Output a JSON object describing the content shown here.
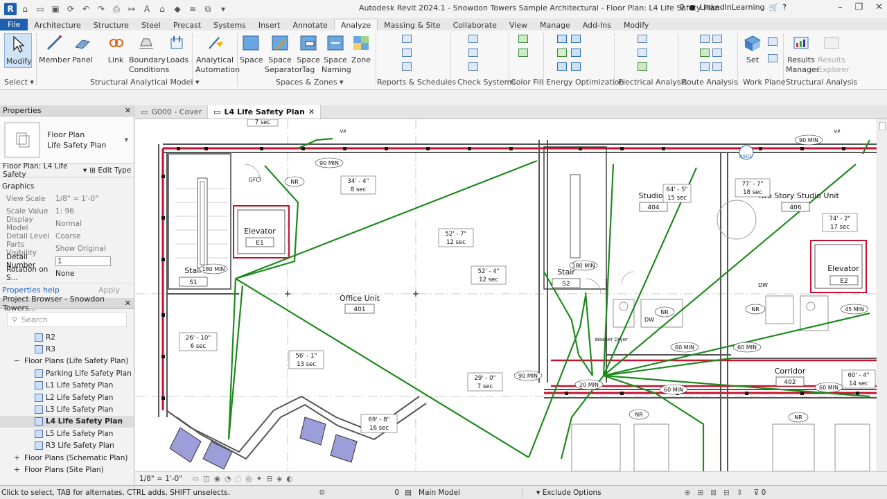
{
  "app": {
    "title": "Autodesk Revit 2024.1 - Snowdon Towers Sample Architectural - Floor Plan: L4 Life Safety Plan",
    "logo": "R",
    "account": "LinkedInLearning"
  },
  "menu_tabs": [
    "File",
    "Architecture",
    "Structure",
    "Steel",
    "Precast",
    "Systems",
    "Insert",
    "Annotate",
    "Analyze",
    "Massing & Site",
    "Collaborate",
    "View",
    "Manage",
    "Add-Ins",
    "Modify"
  ],
  "active_tab": "Analyze",
  "ribbon": {
    "modify": "Modify",
    "member": "Member",
    "panel": "Panel",
    "link": "Link",
    "boundary": "Boundary Conditions",
    "loads": "Loads",
    "analytical_automation": "Analytical Automation",
    "space": "Space",
    "space_separator": "Space Separator",
    "space_tag": "Space Tag",
    "space_naming": "Space Naming",
    "zone": "Zone",
    "set": "Set",
    "results_manager": "Results Manager",
    "results_explorer": "Results Explorer",
    "panels": {
      "select": "Select",
      "structural_analytical_model": "Structural Analytical Model",
      "spaces_zones": "Spaces & Zones",
      "reports": "Reports & Schedules",
      "check": "Check Systems",
      "color_fill": "Color Fill",
      "energy": "Energy Optimization",
      "electrical": "Electrical Analysis",
      "route": "Route Analysis",
      "work_plane": "Work Plane",
      "structural_analysis": "Structural Analysis"
    }
  },
  "properties": {
    "title": "Properties",
    "type_line1": "Floor Plan",
    "type_line2": "Life Safety Plan",
    "selector": "Floor Plan: L4 Life Safety",
    "edit_type": "Edit Type",
    "section": "Graphics",
    "rows": [
      {
        "k": "View Scale",
        "v": "1/8\" = 1'-0\""
      },
      {
        "k": "Scale Value",
        "v": "1:  96"
      },
      {
        "k": "Display Model",
        "v": "Normal"
      },
      {
        "k": "Detail Level",
        "v": "Coarse"
      },
      {
        "k": "Parts Visibility",
        "v": "Show Original"
      },
      {
        "k": "Detail Number",
        "v": "1"
      },
      {
        "k": "Rotation on S...",
        "v": "None"
      }
    ],
    "help": "Properties help",
    "apply": "Apply"
  },
  "browser": {
    "title": "Project Browser - Snowdon Towers...",
    "search_placeholder": "Search",
    "items": [
      "R2",
      "R3",
      "Floor Plans (Life Safety Plan)",
      "Parking Life Safety Plan",
      "L1 Life Safety Plan",
      "L2 Life Safety Plan",
      "L3 Life Safety Plan",
      "L4 Life Safety Plan",
      "L5 Life Safety Plan",
      "R3 Life Safety Plan",
      "Floor Plans (Schematic Plan)",
      "Floor Plans (Site Plan)"
    ]
  },
  "view_tabs": [
    "G000 - Cover",
    "L4 Life Safety Plan"
  ],
  "drawing": {
    "rooms": [
      {
        "name": "Office Unit",
        "num": "401"
      },
      {
        "name": "Studio Unit",
        "num": "404"
      },
      {
        "name": "Two Story Studio Unit",
        "num": "406"
      },
      {
        "name": "Corridor",
        "num": "402"
      },
      {
        "name": "Elevator",
        "num": "E1"
      },
      {
        "name": "Elevator",
        "num": "E2"
      },
      {
        "name": "Stair",
        "num": "S1"
      },
      {
        "name": "Stair",
        "num": "S2"
      }
    ],
    "distances": [
      {
        "d": "7 sec",
        "t": ""
      },
      {
        "d": "34' - 4\"",
        "t": "8 sec"
      },
      {
        "d": "52' - 7\"",
        "t": "12 sec"
      },
      {
        "d": "52' - 4\"",
        "t": "12 sec"
      },
      {
        "d": "26' - 10\"",
        "t": "6 sec"
      },
      {
        "d": "56' - 1\"",
        "t": "13 sec"
      },
      {
        "d": "29' - 0\"",
        "t": "7 sec"
      },
      {
        "d": "69' - 8\"",
        "t": "16 sec"
      },
      {
        "d": "64' - 5\"",
        "t": "15 sec"
      },
      {
        "d": "77' - 7\"",
        "t": "18 sec"
      },
      {
        "d": "74' - 2\"",
        "t": "17 sec"
      },
      {
        "d": "60' - 4\"",
        "t": "14 sec"
      }
    ],
    "ratings": [
      "90 MIN",
      "180 MIN",
      "180 MIN",
      "90 MIN",
      "90 MIN",
      "60 MIN",
      "60 MIN",
      "20 MIN",
      "60 MIN",
      "60 MIN",
      "45 MIN"
    ],
    "labels": [
      "GFCI",
      "NR",
      "NR",
      "NR",
      "NR",
      "NR",
      "DW",
      "DW",
      "Washer Dryer",
      "A501",
      "VP",
      "VP"
    ]
  },
  "view_status": {
    "scale": "1/8\" = 1'-0\""
  },
  "status": {
    "hint": "Click to select, TAB for alternates, CTRL adds, SHIFT unselects.",
    "zero": "0",
    "model": "Main Model",
    "exclude": "Exclude Options",
    "filter": "0"
  },
  "colors": {
    "accent": "#1f5fad",
    "route": "#1e8a1e",
    "wall": "#c8102e"
  }
}
